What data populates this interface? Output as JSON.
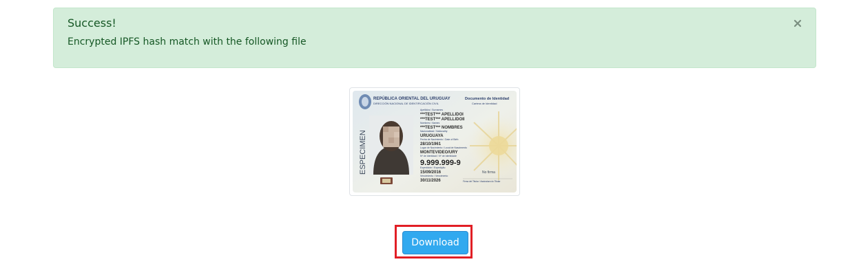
{
  "alert": {
    "title": "Success!",
    "message": "Encrypted IPFS hash match with the following file",
    "close_icon": "close-icon",
    "colors": {
      "background": "#d4edda",
      "border": "#c3e6cb",
      "text": "#155724"
    }
  },
  "id_card": {
    "header_left": "REPÚBLICA ORIENTAL DEL URUGUAY",
    "header_left_sub": "DIRECCIÓN NACIONAL DE IDENTIFICACIÓN CIVIL",
    "header_right": "Documento de Identidad",
    "header_right_sub": "Cartera de Identidad",
    "specimen": "ESPECIMEN",
    "surname_label": "Apellidos / Surnames",
    "surname_1": "***TEST*** APELLIDOI",
    "surname_2": "***TEST*** APELLIDOII",
    "names_label": "Nombres / Names",
    "names": "***TEST*** NOMBRES",
    "nationality_label": "Nacionalidad / Nationality",
    "nationality": "URUGUAYA",
    "birth_date_label": "Fecha de Nacimiento / Date of Birth",
    "birth_date": "28/10/1961",
    "birth_place_label": "Lugar de Nacimiento / Local de Nascimento",
    "birth_place": "MONTEVIDEO/URY",
    "id_label": "Nº de Identidad / Nº de Identidade",
    "id_number": "9.999.999-9",
    "issue_label": "Expedición / Expedição",
    "issue_date": "15/09/2016",
    "expiry_label": "Vencimiento / Vencimento",
    "expiry_date": "30/11/2026",
    "no_signature": "No firma",
    "signature_label": "Firma del Titular / Assinatura do Titular"
  },
  "download": {
    "label": "Download",
    "color": "#31a9ef",
    "highlight_color": "#e11e25"
  }
}
